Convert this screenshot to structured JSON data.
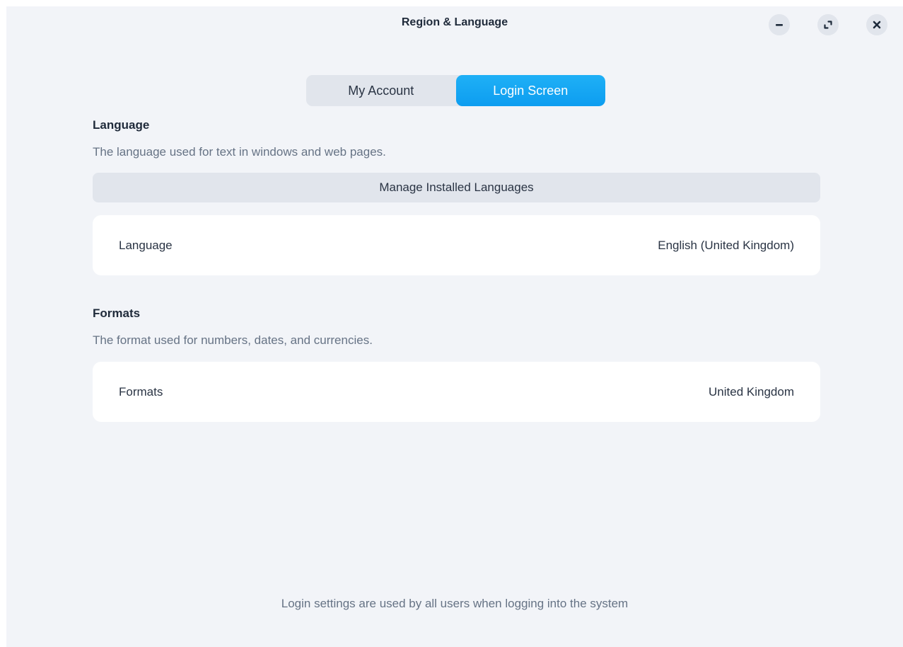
{
  "window": {
    "title": "Region & Language",
    "controls": {
      "minimize_icon": "minimize-icon",
      "maximize_icon": "maximize-icon",
      "close_icon": "close-icon"
    }
  },
  "tabs": [
    {
      "label": "My Account",
      "active": false
    },
    {
      "label": "Login Screen",
      "active": true
    }
  ],
  "language_section": {
    "heading": "Language",
    "description": "The language used for text in windows and web pages.",
    "manage_button": "Manage Installed Languages",
    "row": {
      "label": "Language",
      "value": "English (United Kingdom)"
    }
  },
  "formats_section": {
    "heading": "Formats",
    "description": "The format used for numbers, dates, and currencies.",
    "row": {
      "label": "Formats",
      "value": "United Kingdom"
    }
  },
  "footer": {
    "note": "Login settings are used by all users when logging into the system"
  },
  "colors": {
    "accent": "#0d9df0",
    "background": "#f2f4f8",
    "card": "#ffffff",
    "button": "#e1e5ec"
  }
}
